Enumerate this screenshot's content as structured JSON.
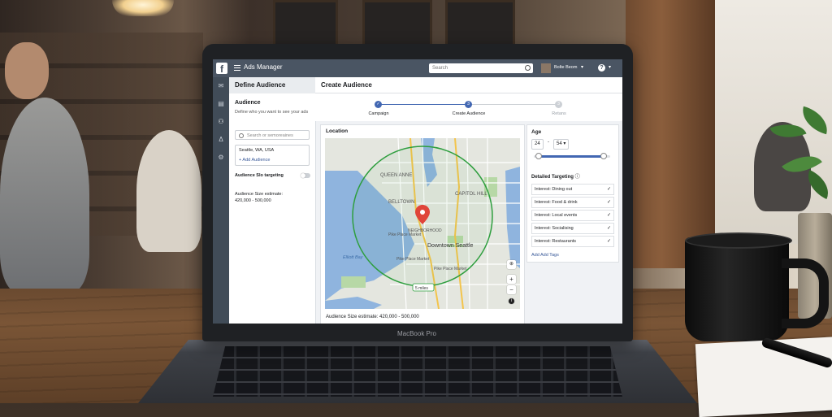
{
  "macbook_label": "MacBook Pro",
  "app": {
    "title": "Ads Manager",
    "search_placeholder": "Search",
    "user_name": "Bolte Beom",
    "help_symbol": "?"
  },
  "define_panel": {
    "heading": "Define Audience",
    "section_title": "Audience",
    "description": "Define who you want to see your ads",
    "search_placeholder": "Search or semoreaines",
    "location": "Seattle, WA, USA",
    "add_label": "+ Add Audience",
    "targeting_label": "Audience Slo targeting",
    "size_label": "Audience Size estimate:",
    "size_value": "420,000 - 500,000"
  },
  "main": {
    "heading": "Create Audience",
    "steps": [
      {
        "label": "Campaign",
        "state": "done"
      },
      {
        "label": "Create Audience",
        "state": "active"
      },
      {
        "label": "Retans",
        "state": "pending"
      }
    ],
    "location_title": "Location",
    "map_labels": {
      "queen_anne": "QUEEN ANNE",
      "belltown": "BELLTOWN",
      "capitol_hill": "CAPITOL HILL",
      "neighborhood": "NEIGHBORHOOD",
      "downtown": "Downtown Seattle",
      "pike_market": "Pike Place Market",
      "pike_market2": "Pike Place Market",
      "pike_market3": "Pike Place Market",
      "elliott_bay": "Elliott Bay",
      "radius": "5 miles"
    },
    "size_estimate": "Audience Size estimate: 420,000 - 500,000"
  },
  "targeting": {
    "age_title": "Age",
    "age_min": "24",
    "age_max": "54",
    "age_range_fraction": [
      0.06,
      0.91
    ],
    "detailed_title": "Detailed Targeting",
    "interests": [
      "Interest: Dining out",
      "Interest: Food & drink",
      "Interest: Local events",
      "Interest: Socialising",
      "Interest: Restaurants"
    ],
    "add_tags": "Add Add Tags"
  },
  "colors": {
    "topbar": "#4a5563",
    "accent": "#4267b2",
    "radius_circle": "#2e9e3e",
    "pin": "#e0453a"
  }
}
